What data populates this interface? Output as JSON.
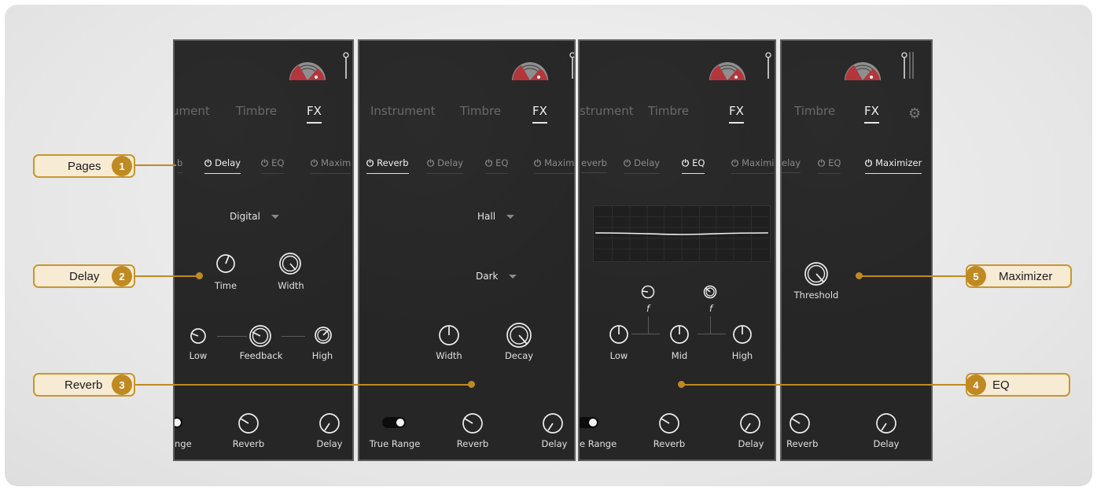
{
  "callouts": [
    {
      "label": "Pages",
      "number": "1"
    },
    {
      "label": "Delay",
      "number": "2"
    },
    {
      "label": "Reverb",
      "number": "3"
    },
    {
      "label": "EQ",
      "number": "4"
    },
    {
      "label": "Maximizer",
      "number": "5"
    }
  ],
  "colors": {
    "accent": "#bf8a22",
    "callout_bg": "#f8ebd4",
    "panel_bg": "#262626",
    "logo_red": "#b3363c"
  },
  "icons": {
    "power": "⏻",
    "gear": "⚙",
    "logo": "gauge-logo-icon",
    "slider": "level-slider-icon"
  },
  "tabs": {
    "instrument": "Instrument",
    "instrument_cut1": "ument",
    "instrument_cut2": "strument",
    "timbre": "Timbre",
    "fx": "FX"
  },
  "effects": {
    "reverb": "Reverb",
    "reverb_cut1": "b",
    "reverb_cut2": "everb",
    "delay": "Delay",
    "delay_cut": "elay",
    "eq": "EQ",
    "maximizer": "Maximizer",
    "maximizer_cut": "Maxim",
    "maximizer_cut2": "Maximi"
  },
  "delay_panel": {
    "mode": "Digital",
    "time": "Time",
    "width": "Width",
    "low": "Low",
    "feedback": "Feedback",
    "high": "High",
    "true_range_cut": "nge",
    "reverb_send": "Reverb",
    "delay_send": "Delay"
  },
  "reverb_panel": {
    "type": "Hall",
    "color": "Dark",
    "width": "Width",
    "decay": "Decay",
    "true_range": "True Range",
    "reverb_send": "Reverb",
    "delay_send": "Delay"
  },
  "eq_panel": {
    "freq_symbol": "f",
    "low": "Low",
    "mid": "Mid",
    "high": "High",
    "true_range_cut": "e Range",
    "reverb_send": "Reverb",
    "delay_send": "Delay"
  },
  "maximizer_panel": {
    "threshold": "Threshold",
    "reverb_send": "Reverb",
    "delay_send": "Delay"
  }
}
